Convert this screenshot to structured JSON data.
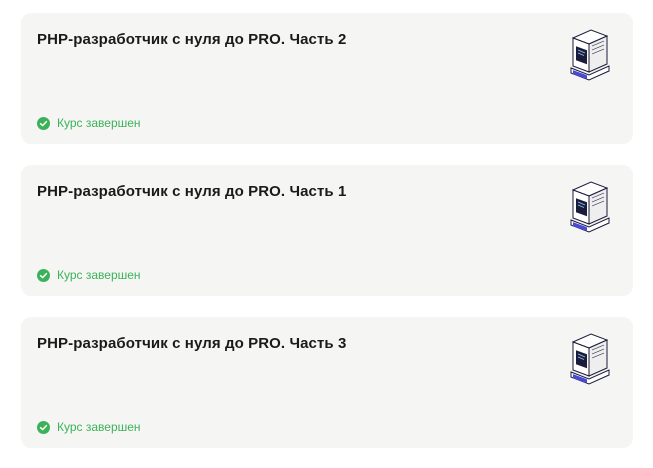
{
  "colors": {
    "card_background": "#f5f5f3",
    "title": "#1a1a1a",
    "status_green": "#3bb25a"
  },
  "courses": [
    {
      "title": "PHP-разработчик с нуля до PRO. Часть 2",
      "status": "Курс завершен",
      "status_icon": "check-circle-icon",
      "illustration": "server-box-icon"
    },
    {
      "title": "PHP-разработчик с нуля до PRO. Часть 1",
      "status": "Курс завершен",
      "status_icon": "check-circle-icon",
      "illustration": "server-box-icon"
    },
    {
      "title": "PHP-разработчик с нуля до PRO. Часть 3",
      "status": "Курс завершен",
      "status_icon": "check-circle-icon",
      "illustration": "server-box-icon"
    }
  ]
}
